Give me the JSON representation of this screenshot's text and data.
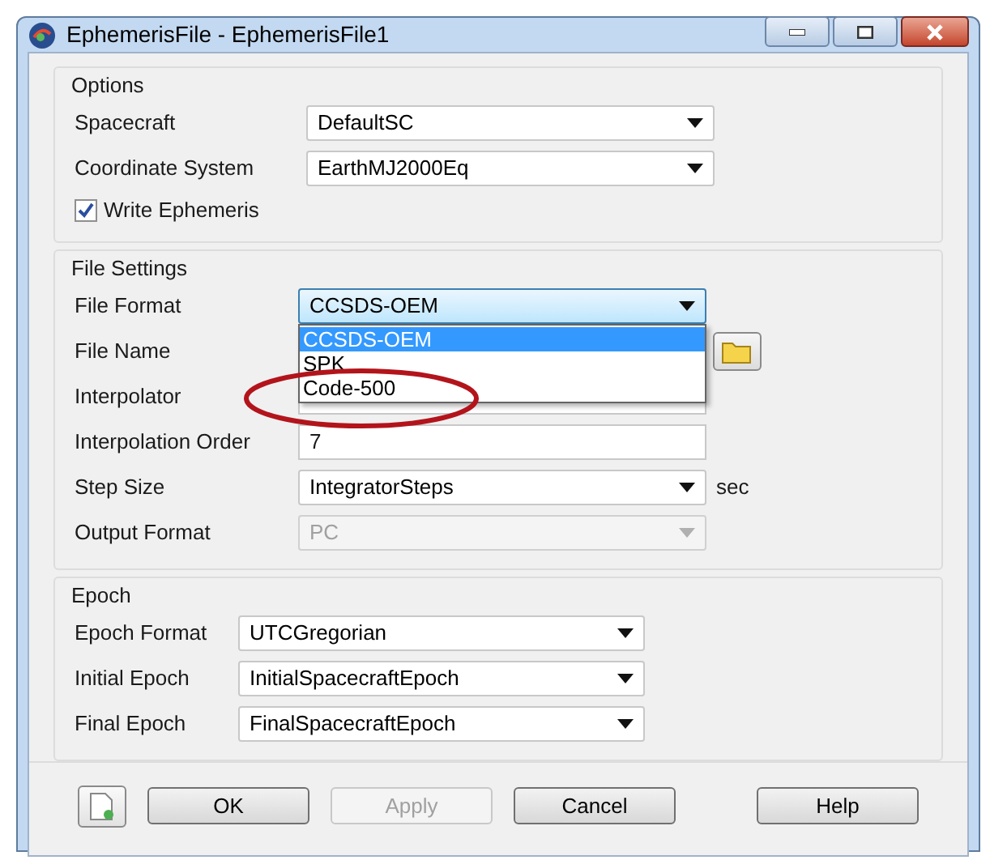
{
  "window": {
    "title": "EphemerisFile - EphemerisFile1"
  },
  "options": {
    "title": "Options",
    "rows": [
      {
        "kind": "combo",
        "label": "Spacecraft",
        "value": "DefaultSC",
        "disabled": false
      },
      {
        "kind": "combo",
        "label": "Coordinate System",
        "value": "EarthMJ2000Eq",
        "disabled": false
      },
      {
        "kind": "check",
        "label": "Write Ephemeris",
        "checked": true
      }
    ]
  },
  "file_settings": {
    "title": "File Settings",
    "rows": [
      {
        "kind": "combo",
        "label": "File Format",
        "value": "CCSDS-OEM",
        "disabled": false,
        "expanded": true,
        "options": [
          {
            "label": "CCSDS-OEM",
            "selected": true
          },
          {
            "label": "SPK",
            "selected": false
          },
          {
            "label": "Code-500",
            "selected": false
          }
        ]
      },
      {
        "kind": "file",
        "label": "File Name"
      },
      {
        "kind": "text",
        "label": "Interpolator"
      },
      {
        "kind": "text",
        "label": "Interpolation Order",
        "value": "7"
      },
      {
        "kind": "combo",
        "label": "Step Size",
        "value": "IntegratorSteps",
        "disabled": false,
        "unit": "sec"
      },
      {
        "kind": "combo",
        "label": "Output Format",
        "value": "PC",
        "disabled": true
      }
    ]
  },
  "epoch": {
    "title": "Epoch",
    "rows": [
      {
        "kind": "combo",
        "label": "Epoch Format",
        "value": "UTCGregorian",
        "disabled": false
      },
      {
        "kind": "combo",
        "label": "Initial Epoch",
        "value": "InitialSpacecraftEpoch",
        "disabled": false
      },
      {
        "kind": "combo",
        "label": "Final Epoch",
        "value": "FinalSpacecraftEpoch",
        "disabled": false
      }
    ]
  },
  "buttons": [
    {
      "label": "OK",
      "disabled": false
    },
    {
      "label": "Apply",
      "disabled": true
    },
    {
      "label": "Cancel",
      "disabled": false
    },
    {
      "label": "Help",
      "disabled": false
    }
  ]
}
